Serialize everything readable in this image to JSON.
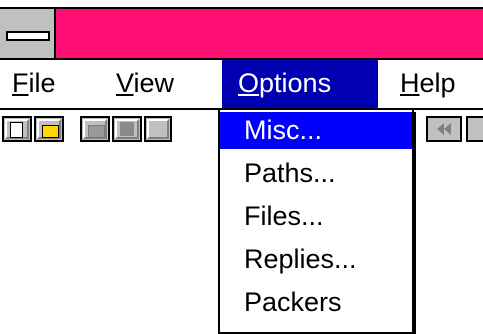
{
  "menubar": {
    "items": [
      {
        "id": "file",
        "label": "File"
      },
      {
        "id": "view",
        "label": "View"
      },
      {
        "id": "options",
        "label": "Options"
      },
      {
        "id": "help",
        "label": "Help"
      }
    ]
  },
  "options_menu": {
    "items": [
      {
        "label": "Misc...",
        "selected": true
      },
      {
        "label": "Paths..."
      },
      {
        "label": "Files..."
      },
      {
        "label": "Replies..."
      },
      {
        "label": "Packers"
      }
    ]
  },
  "toolbar": {
    "buttons": [
      "new-document-icon",
      "open-folder-icon",
      "folder-icon-disabled",
      "save-icon-disabled",
      "rewind-icon"
    ]
  },
  "colors": {
    "title_bar": "#ff0f73",
    "menu_highlight": "#0000b0",
    "selected_item": "#0000ff",
    "button_face": "#c0c0c0"
  }
}
